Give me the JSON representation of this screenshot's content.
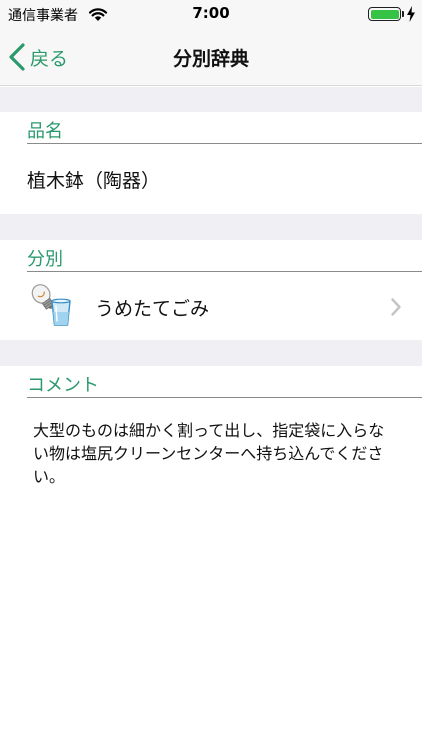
{
  "status_bar": {
    "carrier": "通信事業者",
    "time": "7:00",
    "battery_level": 1.0
  },
  "nav": {
    "back_label": "戻る",
    "title": "分別辞典"
  },
  "sections": {
    "item_name_header": "品名",
    "item_name_value": "植木鉢（陶器）",
    "category_header": "分別",
    "category_value": "うめたてごみ",
    "category_icon": "lightbulb-and-glass-icon",
    "comment_header": "コメント",
    "comment_text": "大型のものは細かく割って出し、指定袋に入らない物は塩尻クリーンセンターへ持ち込んでください。"
  },
  "colors": {
    "accent": "#2a9a6d",
    "battery": "#36c244",
    "gap_background": "#efeff4",
    "bar_background": "#f7f7f7"
  }
}
